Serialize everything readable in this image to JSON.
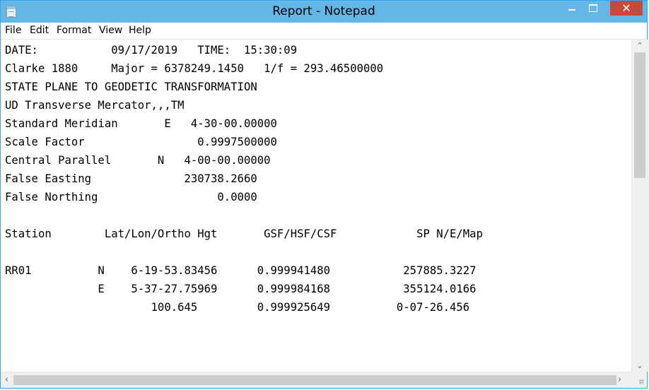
{
  "window": {
    "title": "Report - Notepad",
    "close_glyph": "✕",
    "icons": {
      "app": "notepad-icon",
      "minimize": "minimize-icon",
      "maximize": "maximize-icon",
      "close": "close-icon"
    },
    "colors": {
      "titlebar": "#64b6e6",
      "close_button": "#c9473d",
      "window_border": "#36a7e6"
    }
  },
  "menu": {
    "items": [
      {
        "id": "file",
        "label": "File"
      },
      {
        "id": "edit",
        "label": "Edit"
      },
      {
        "id": "format",
        "label": "Format"
      },
      {
        "id": "view",
        "label": "View"
      },
      {
        "id": "help",
        "label": "Help"
      }
    ]
  },
  "document": {
    "lines": [
      "DATE:           09/17/2019   TIME:  15:30:09",
      "Clarke 1880     Major = 6378249.1450   1/f = 293.46500000",
      "STATE PLANE TO GEODETIC TRANSFORMATION",
      "UD Transverse Mercator,,,TM",
      "Standard Meridian       E   4-30-00.00000",
      "Scale Factor                 0.9997500000",
      "Central Parallel       N   4-00-00.00000",
      "False Easting              230738.2660",
      "False Northing                  0.0000",
      "",
      "Station        Lat/Lon/Ortho Hgt       GSF/HSF/CSF            SP N/E/Map",
      "",
      "RR01          N    6-19-53.83456      0.999941480           257885.3227",
      "              E    5-37-27.75969      0.999984168           355124.0166",
      "                      100.645         0.999925649          0-07-26.456"
    ]
  },
  "scrollbars": {
    "up_arrow": "⌃",
    "down_arrow": "⌄",
    "left_arrow": "‹",
    "right_arrow": "›"
  }
}
